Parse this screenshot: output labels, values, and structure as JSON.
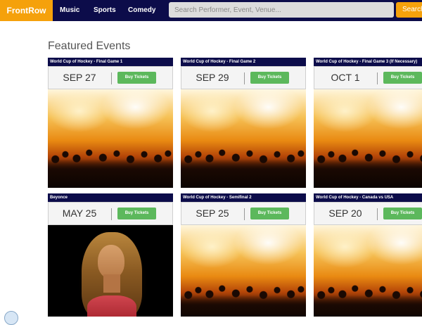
{
  "header": {
    "brand": "FrontRow",
    "nav": [
      "Music",
      "Sports",
      "Comedy"
    ],
    "search_placeholder": "Search Performer, Event, Venue...",
    "search_button": "Search"
  },
  "main": {
    "section_title": "Featured Events",
    "events": [
      {
        "title": "World Cup of Hockey - Final Game 1",
        "date": "SEP 27",
        "button": "Buy Tickets"
      },
      {
        "title": "World Cup of Hockey - Final Game 2",
        "date": "SEP 29",
        "button": "Buy Tickets"
      },
      {
        "title": "World Cup of Hockey - Final Game 3 (If Necessary)",
        "date": "OCT 1",
        "button": "Buy Tickets"
      },
      {
        "title": "Beyonce",
        "date": "MAY 25",
        "button": "Buy Tickets"
      },
      {
        "title": "World Cup of Hockey - Semifinal 2",
        "date": "SEP 25",
        "button": "Buy Tickets"
      },
      {
        "title": "World Cup of Hockey - Canada vs USA",
        "date": "SEP 20",
        "button": "Buy Tickets"
      }
    ]
  },
  "colors": {
    "nav_background": "#0c0c4a",
    "brand_orange": "#f5a10b",
    "buy_green": "#5cb85c"
  }
}
